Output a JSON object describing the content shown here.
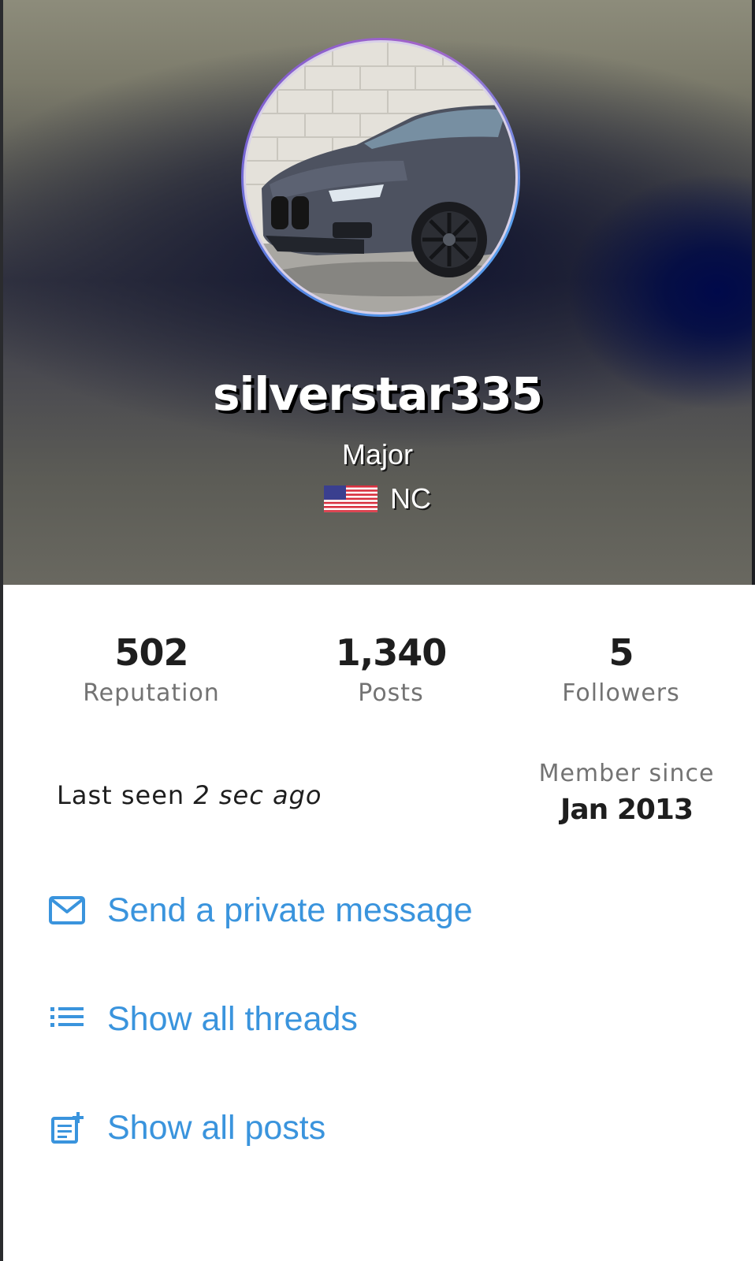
{
  "profile": {
    "username": "silverstar335",
    "rank": "Major",
    "location": "NC",
    "flag_icon": "us-flag-icon",
    "avatar_icon": "car-avatar-image"
  },
  "stats": [
    {
      "value": "502",
      "label": "Reputation"
    },
    {
      "value": "1,340",
      "label": "Posts"
    },
    {
      "value": "5",
      "label": "Followers"
    }
  ],
  "activity": {
    "last_seen_prefix": "Last seen",
    "last_seen_time": "2 sec ago",
    "member_since_label": "Member since",
    "member_since_date": "Jan 2013"
  },
  "actions": [
    {
      "label": "Send a private message",
      "icon": "envelope-icon"
    },
    {
      "label": "Show all threads",
      "icon": "list-icon"
    },
    {
      "label": "Show all posts",
      "icon": "posts-icon"
    }
  ],
  "colors": {
    "link": "#3a94dd",
    "text_dark": "#1e1e1e",
    "text_muted": "#737373"
  }
}
